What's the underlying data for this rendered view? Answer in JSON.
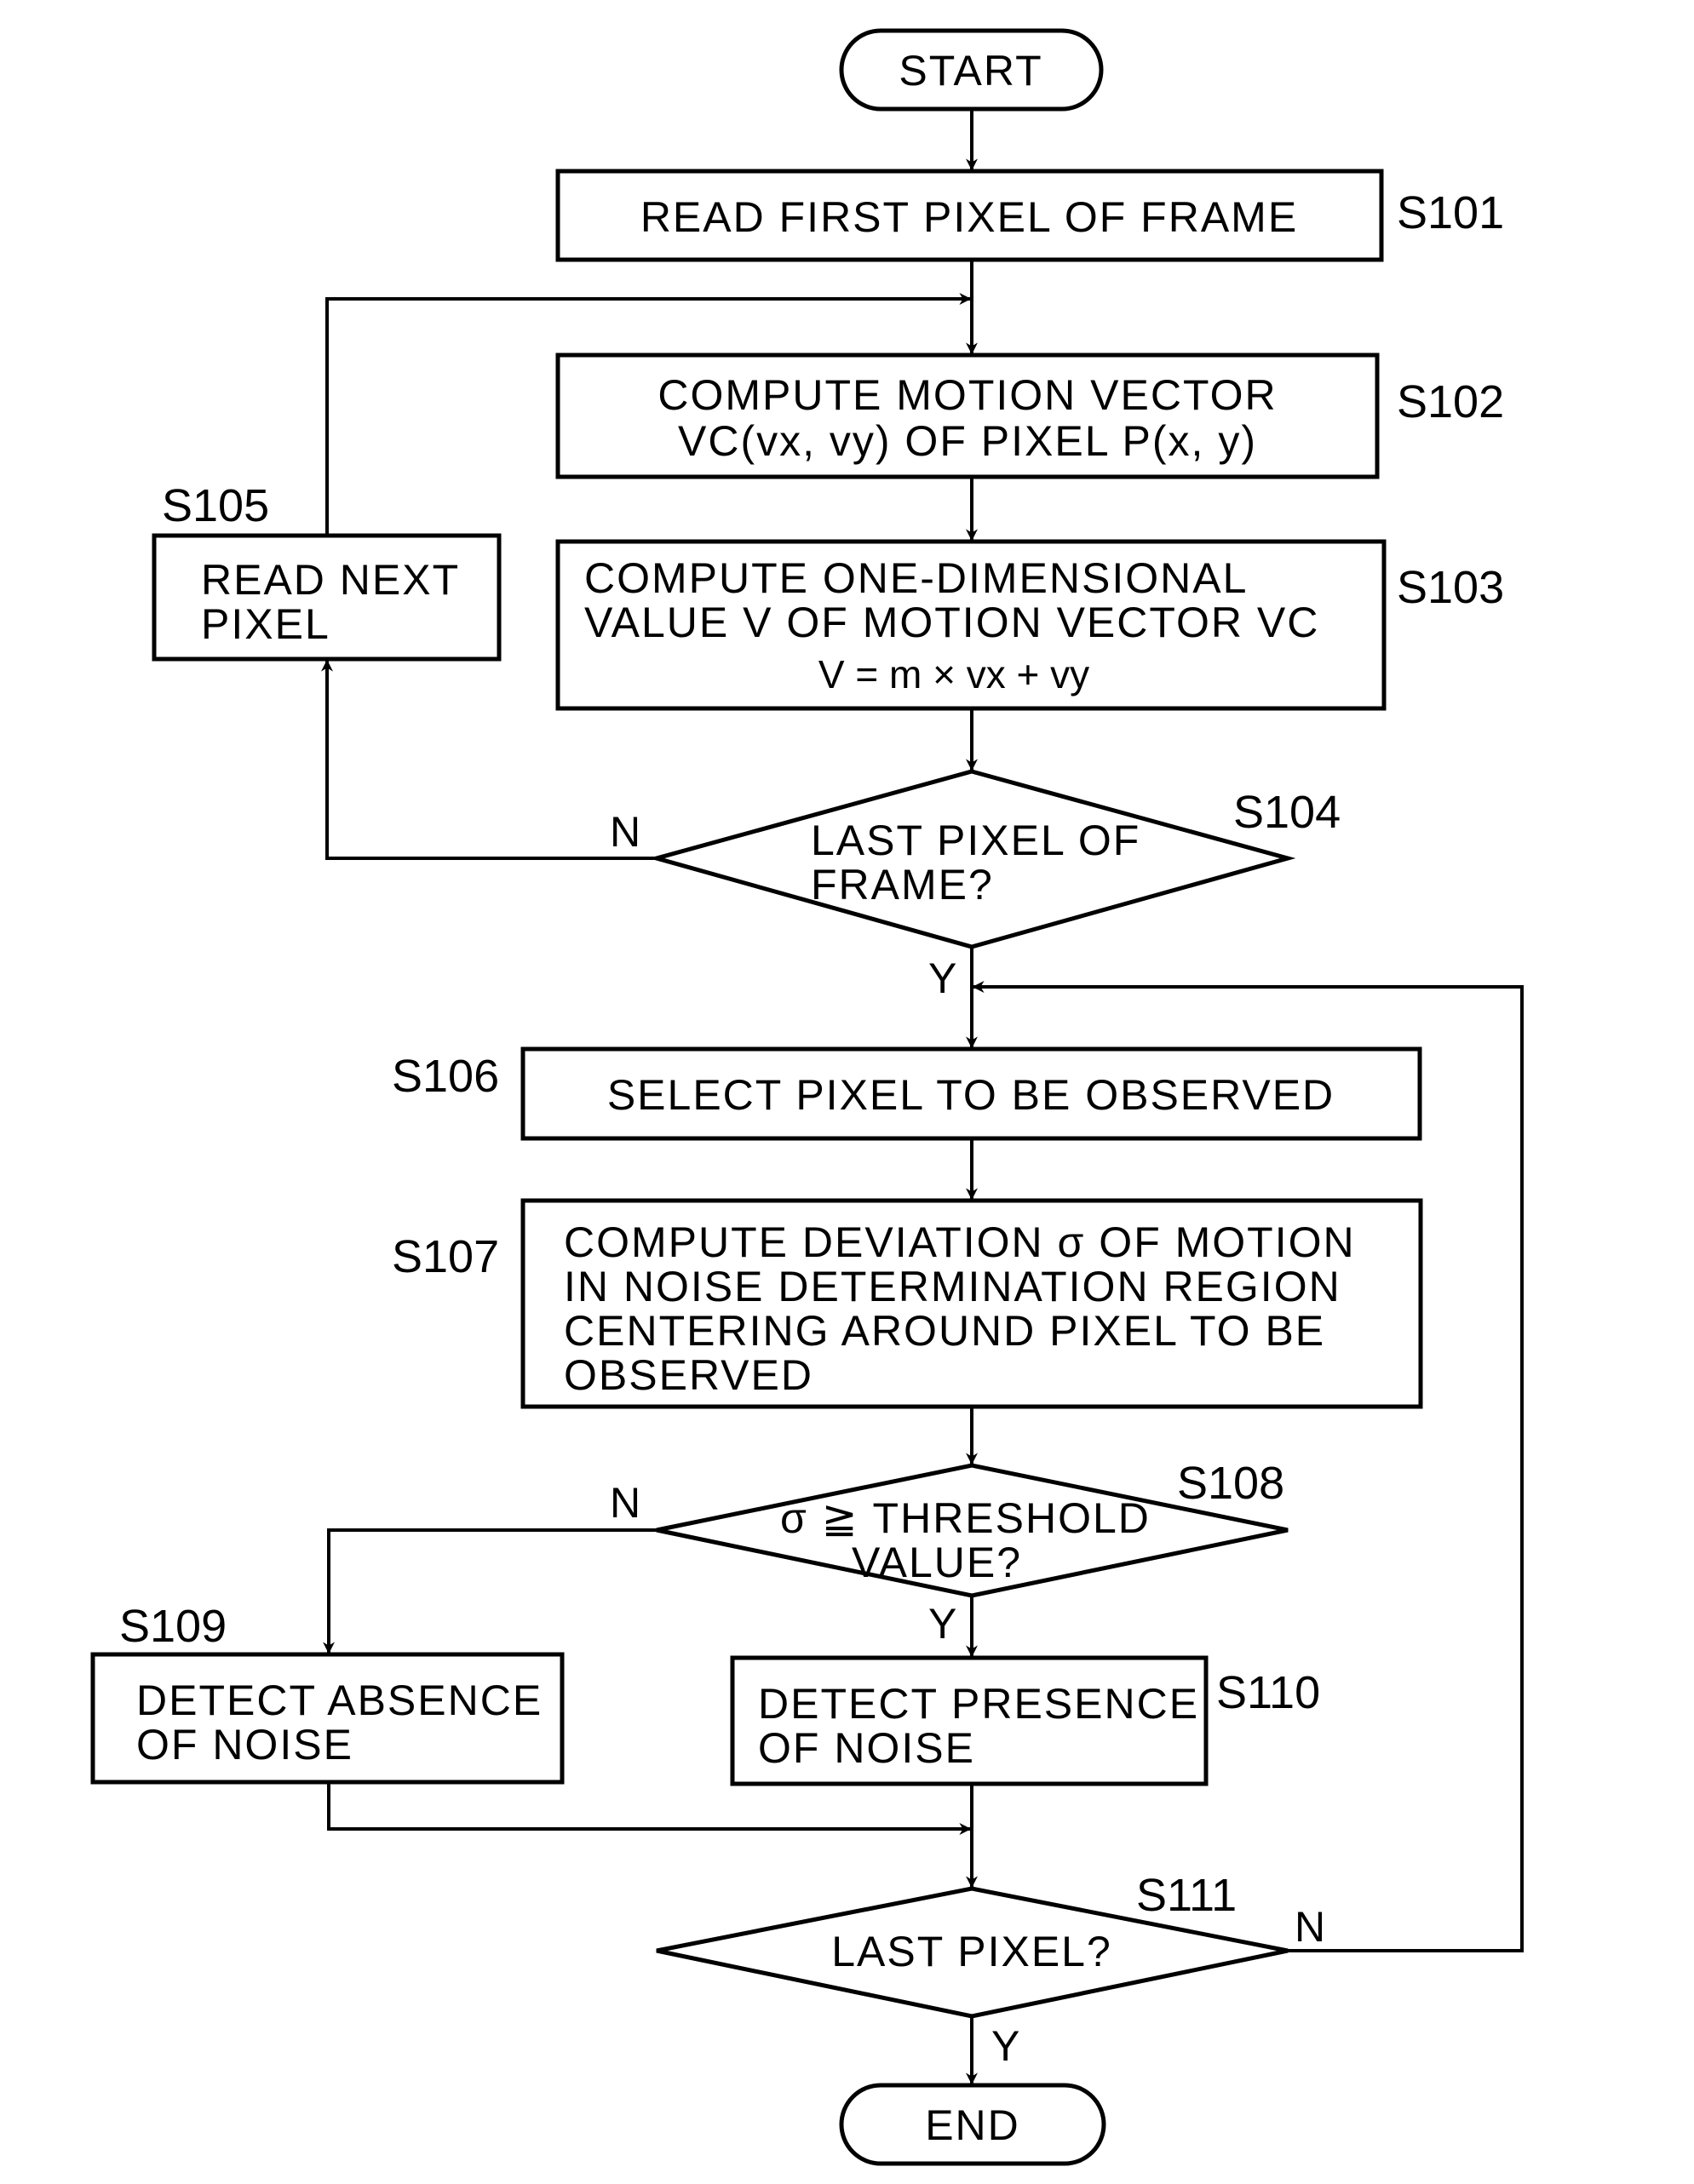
{
  "diagram": {
    "type": "flowchart",
    "terminals": {
      "start": "START",
      "end": "END"
    },
    "steps": {
      "S101": {
        "id": "S101",
        "lines": [
          "READ FIRST PIXEL OF FRAME"
        ]
      },
      "S102": {
        "id": "S102",
        "lines": [
          "COMPUTE MOTION VECTOR",
          "VC(vx, vy) OF PIXEL P(x, y)"
        ]
      },
      "S103": {
        "id": "S103",
        "lines": [
          "COMPUTE ONE-DIMENSIONAL",
          "VALUE V OF MOTION VECTOR VC",
          "V = m × vx + vy"
        ]
      },
      "S104": {
        "id": "S104",
        "lines": [
          "LAST PIXEL OF",
          "FRAME?"
        ]
      },
      "S105": {
        "id": "S105",
        "lines": [
          "READ NEXT",
          "PIXEL"
        ]
      },
      "S106": {
        "id": "S106",
        "lines": [
          "SELECT PIXEL TO BE OBSERVED"
        ]
      },
      "S107": {
        "id": "S107",
        "lines": [
          "COMPUTE DEVIATION σ OF MOTION",
          "IN NOISE DETERMINATION REGION",
          "CENTERING AROUND PIXEL TO BE",
          "OBSERVED"
        ]
      },
      "S108": {
        "id": "S108",
        "lines": [
          "σ ≧ THRESHOLD",
          "VALUE?"
        ]
      },
      "S109": {
        "id": "S109",
        "lines": [
          "DETECT ABSENCE",
          "OF NOISE"
        ]
      },
      "S110": {
        "id": "S110",
        "lines": [
          "DETECT PRESENCE",
          "OF NOISE"
        ]
      },
      "S111": {
        "id": "S111",
        "lines": [
          "LAST PIXEL?"
        ]
      }
    },
    "branch_labels": {
      "yes": "Y",
      "no": "N"
    },
    "edges": [
      {
        "from": "START",
        "to": "S101"
      },
      {
        "from": "S101",
        "to": "S102"
      },
      {
        "from": "S102",
        "to": "S103"
      },
      {
        "from": "S103",
        "to": "S104"
      },
      {
        "from": "S104",
        "to": "S105",
        "label": "N"
      },
      {
        "from": "S105",
        "to": "S102"
      },
      {
        "from": "S104",
        "to": "S106",
        "label": "Y"
      },
      {
        "from": "S106",
        "to": "S107"
      },
      {
        "from": "S107",
        "to": "S108"
      },
      {
        "from": "S108",
        "to": "S109",
        "label": "N"
      },
      {
        "from": "S108",
        "to": "S110",
        "label": "Y"
      },
      {
        "from": "S109",
        "to": "S111"
      },
      {
        "from": "S110",
        "to": "S111"
      },
      {
        "from": "S111",
        "to": "S106",
        "label": "N"
      },
      {
        "from": "S111",
        "to": "END",
        "label": "Y"
      }
    ]
  }
}
